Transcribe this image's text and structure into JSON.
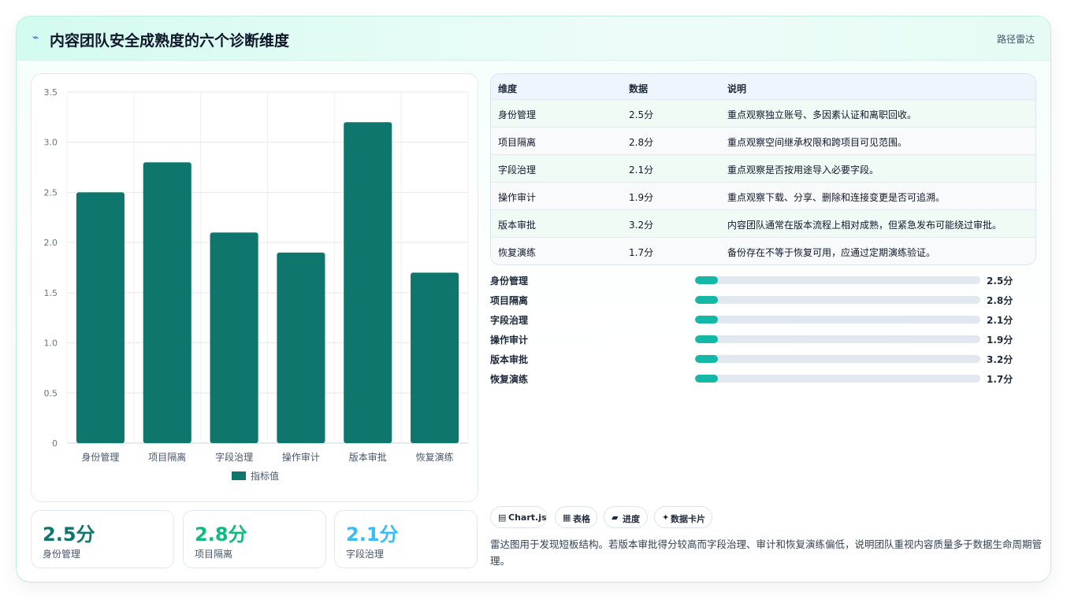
{
  "header": {
    "icon": "⌁",
    "title": "内容团队安全成熟度的六个诊断维度",
    "tag": "路径雷达"
  },
  "chart_data": {
    "type": "bar",
    "categories": [
      "身份管理",
      "项目隔离",
      "字段治理",
      "操作审计",
      "版本审批",
      "恢复演练"
    ],
    "series": [
      {
        "name": "指标值",
        "values": [
          2.5,
          2.8,
          2.1,
          1.9,
          3.2,
          1.7
        ]
      }
    ],
    "ylim": [
      0,
      3.5
    ],
    "yticks": [
      "0",
      "0.5",
      "1.0",
      "1.5",
      "2.0",
      "2.5",
      "3.0",
      "3.5"
    ],
    "legend": "bottom",
    "grid": true,
    "color": "#0f766e"
  },
  "stats": [
    {
      "value": "2.5分",
      "label": "身份管理",
      "color": "#0f766e"
    },
    {
      "value": "2.8分",
      "label": "项目隔离",
      "color": "#10b981"
    },
    {
      "value": "2.1分",
      "label": "字段治理",
      "color": "#38bdf8"
    }
  ],
  "table": {
    "headers": [
      "维度",
      "数据",
      "说明"
    ],
    "rows": [
      [
        "身份管理",
        "2.5分",
        "重点观察独立账号、多因素认证和离职回收。"
      ],
      [
        "项目隔离",
        "2.8分",
        "重点观察空间继承权限和跨项目可见范围。"
      ],
      [
        "字段治理",
        "2.1分",
        "重点观察是否按用途导入必要字段。"
      ],
      [
        "操作审计",
        "1.9分",
        "重点观察下载、分享、删除和连接变更是否可追溯。"
      ],
      [
        "版本审批",
        "3.2分",
        "内容团队通常在版本流程上相对成熟，但紧急发布可能绕过审批。"
      ],
      [
        "恢复演练",
        "1.7分",
        "备份存在不等于恢复可用，应通过定期演练验证。"
      ]
    ]
  },
  "progress": [
    {
      "label": "身份管理",
      "value": "2.5分",
      "fraction": 0.08
    },
    {
      "label": "项目隔离",
      "value": "2.8分",
      "fraction": 0.08
    },
    {
      "label": "字段治理",
      "value": "2.1分",
      "fraction": 0.08
    },
    {
      "label": "操作审计",
      "value": "1.9分",
      "fraction": 0.08
    },
    {
      "label": "版本审批",
      "value": "3.2分",
      "fraction": 0.08
    },
    {
      "label": "恢复演练",
      "value": "1.7分",
      "fraction": 0.08
    }
  ],
  "chips": [
    {
      "icon": "▤",
      "label": "Chart.js"
    },
    {
      "icon": "▦",
      "label": "表格"
    },
    {
      "icon": "▰",
      "label": "进度"
    },
    {
      "icon": "✦",
      "label": "数据卡片"
    }
  ],
  "note": "雷达图用于发现短板结构。若版本审批得分较高而字段治理、审计和恢复演练偏低，说明团队重视内容质量多于数据生命周期管理。"
}
